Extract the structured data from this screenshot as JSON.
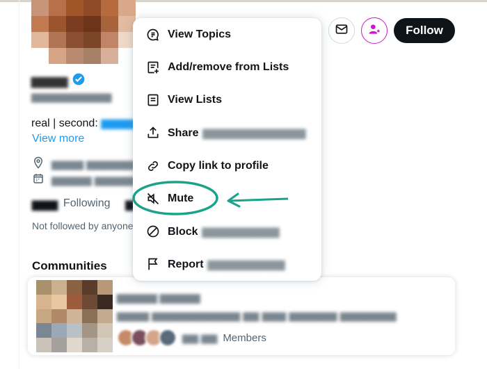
{
  "profile": {
    "name": "▆▆▆▆",
    "handle": "▆▆▆▆▆▆▆▆▆▆",
    "bio_prefix": "real | second:",
    "bio_link": "▆▆▆▆▆",
    "view_more": "View more",
    "location": "▆▆▆▆ ▆▆▆▆▆▆▆ ▆▆▆▆",
    "joined": "▆▆▆▆▆ ▆▆▆▆▆▆",
    "following_count": "▆▆▆",
    "following_label": "Following",
    "followers_count": "▆▆",
    "not_followed": "Not followed by anyone"
  },
  "actions": {
    "follow_label": "Follow",
    "message_icon": "mail-icon",
    "subscribe_icon": "person-star-icon"
  },
  "menu": {
    "items": [
      {
        "label": "View Topics",
        "icon": "topics-icon",
        "extra": ""
      },
      {
        "label": "Add/remove from Lists",
        "icon": "lists-add-icon",
        "extra": ""
      },
      {
        "label": "View Lists",
        "icon": "lists-icon",
        "extra": ""
      },
      {
        "label": "Share",
        "icon": "share-icon",
        "extra": "▆▆▆▆▆▆▆▆▆▆▆▆"
      },
      {
        "label": "Copy link to profile",
        "icon": "link-icon",
        "extra": ""
      },
      {
        "label": "Mute",
        "icon": "mute-icon",
        "extra": ""
      },
      {
        "label": "Block",
        "icon": "block-icon",
        "extra": "▆▆▆▆▆▆▆▆▆"
      },
      {
        "label": "Report",
        "icon": "flag-icon",
        "extra": "▆▆▆▆▆▆▆▆▆"
      }
    ]
  },
  "communities": {
    "heading": "Communities",
    "title": "▆▆▆▆▆ ▆▆▆▆▆",
    "description": "▆▆▆▆ ▆▆▆▆▆▆▆▆▆▆▆ ▆▆ ▆▆▆ ▆▆▆▆▆▆ ▆▆▆▆▆▆▆",
    "members_count": "▆▆.▆▆",
    "members_label": "Members"
  },
  "colors": {
    "accent": "#1d9bf0",
    "follow_bg": "#0f1419",
    "highlight": "#1aa38a",
    "subscribe": "#c918c9"
  }
}
